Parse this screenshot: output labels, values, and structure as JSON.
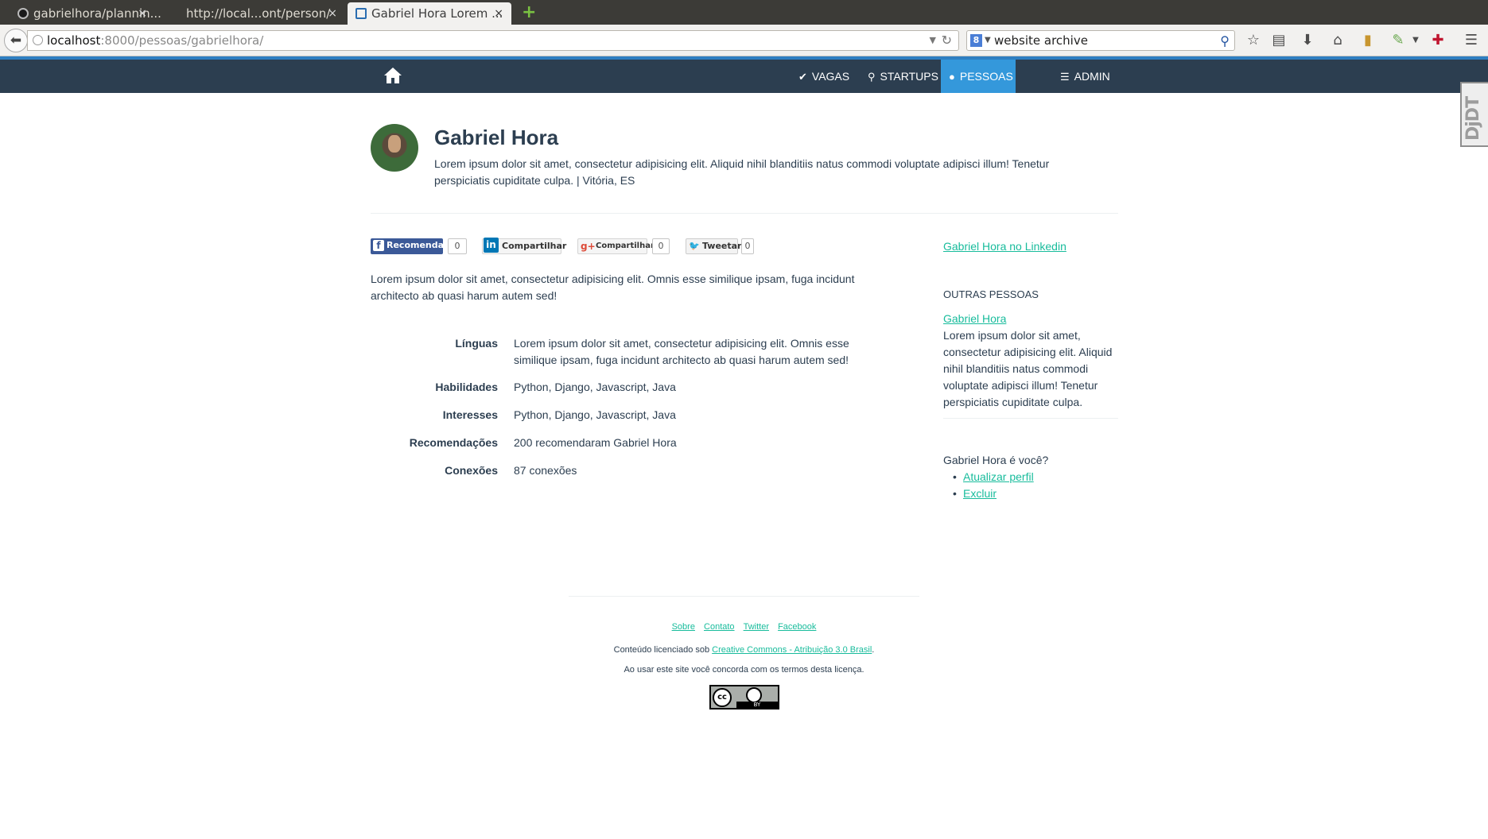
{
  "browser": {
    "tabs": [
      {
        "title": "gabrielhora/plannin...",
        "close": "×"
      },
      {
        "title": "http://local...ont/person/",
        "close": "×"
      },
      {
        "title": "Gabriel Hora Lorem ...",
        "close": "×"
      }
    ],
    "new_tab": "+",
    "url_host": "localhost",
    "url_path": ":8000/pessoas/gabrielhora/",
    "search_value": "website archive",
    "search_engine_icon": "8"
  },
  "site": {
    "nav": {
      "vagas": "VAGAS",
      "startups": "STARTUPS",
      "pessoas": "PESSOAS",
      "admin": "ADMIN"
    },
    "djdt": "DjDT"
  },
  "person": {
    "name": "Gabriel Hora",
    "description": "Lorem ipsum dolor sit amet, consectetur adipisicing elit. Aliquid nihil blanditiis natus commodi voluptate adipisci illum! Tenetur perspiciatis cupiditate culpa. | Vitória, ES",
    "about": "Lorem ipsum dolor sit amet, consectetur adipisicing elit. Omnis esse similique ipsam, fuga incidunt architecto ab quasi harum autem sed!",
    "details": [
      {
        "label": "Línguas",
        "value": "Lorem ipsum dolor sit amet, consectetur adipisicing elit. Omnis esse similique ipsam, fuga incidunt architecto ab quasi harum autem sed!"
      },
      {
        "label": "Habilidades",
        "value": "Python, Django, Javascript, Java"
      },
      {
        "label": "Interesses",
        "value": "Python, Django, Javascript, Java"
      },
      {
        "label": "Recomendações",
        "value": "200 recomendaram Gabriel Hora"
      },
      {
        "label": "Conexões",
        "value": "87 conexões"
      }
    ]
  },
  "share": {
    "facebook": "Recomendar",
    "facebook_count": "0",
    "linkedin": "Compartilhar",
    "google": "Compartilhar",
    "google_count": "0",
    "twitter": "Tweetar",
    "twitter_count": "0"
  },
  "sidebar": {
    "linkedin_link": "Gabriel Hora no Linkedin",
    "others_title": "OUTRAS PESSOAS",
    "other_name": "Gabriel Hora",
    "other_desc": "Lorem ipsum dolor sit amet, consectetur adipisicing elit. Aliquid nihil blanditiis natus commodi voluptate adipisci illum! Tenetur perspiciatis cupiditate culpa.",
    "is_you": "Gabriel Hora é você?",
    "update": "Atualizar perfil",
    "delete": "Excluir"
  },
  "footer": {
    "links": [
      "Sobre",
      "Contato",
      "Twitter",
      "Facebook"
    ],
    "license_prefix": "Conteúdo licenciado sob ",
    "license_link": "Creative Commons - Atribuição 3.0 Brasil",
    "license_suffix": ".",
    "terms": "Ao usar este site você concorda com os termos desta licença.",
    "cc_text": "cc",
    "by_text": "BY"
  },
  "colors": {
    "navbar": "#2c3e50",
    "nav_active": "#3498db",
    "link": "#18bc9c",
    "text": "#2c3e50"
  }
}
